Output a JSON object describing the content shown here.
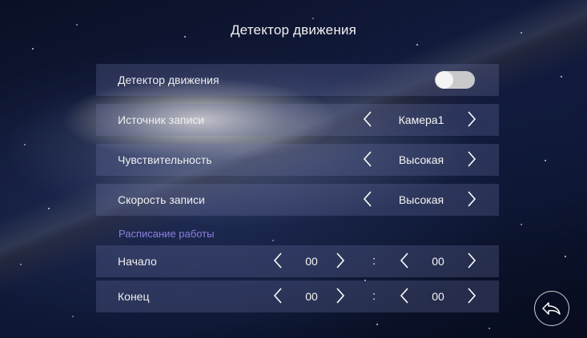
{
  "page": {
    "title": "Детектор движения"
  },
  "rows": {
    "motion_detector": {
      "label": "Детектор движения",
      "toggle_on": true
    },
    "record_source": {
      "label": "Источник записи",
      "value": "Камера1"
    },
    "sensitivity": {
      "label": "Чувствительность",
      "value": "Высокая"
    },
    "record_speed": {
      "label": "Скорость записи",
      "value": "Высокая"
    }
  },
  "schedule": {
    "section_label": "Расписание работы",
    "start": {
      "label": "Начало",
      "hours": "00",
      "minutes": "00"
    },
    "end": {
      "label": "Конец",
      "hours": "00",
      "minutes": "00"
    },
    "separator": ":"
  },
  "icons": {
    "prev": "chevron-left-icon",
    "next": "chevron-right-icon",
    "back": "back-arrow-icon"
  },
  "colors": {
    "row_bg": "#6e78aa",
    "section_label": "#8c7fe0",
    "toggle_track": "#c9c9cc"
  }
}
